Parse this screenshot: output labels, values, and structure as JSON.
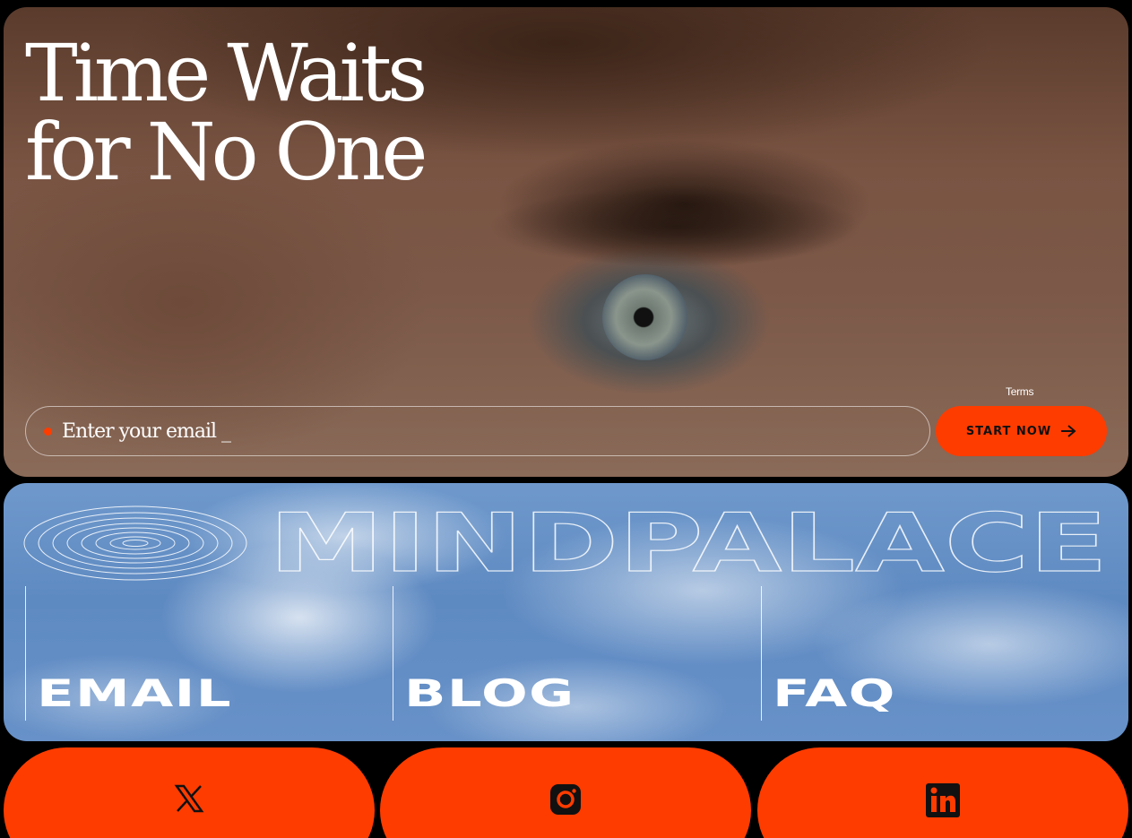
{
  "hero": {
    "title_line1": "Time Waits",
    "title_line2": "for No One",
    "terms_link": "Terms",
    "email_placeholder": "Enter your email _",
    "start_button": "START NOW"
  },
  "brand": {
    "name": "MINDPALACE"
  },
  "nav": [
    {
      "label": "EMAIL"
    },
    {
      "label": "BLOG"
    },
    {
      "label": "FAQ"
    }
  ],
  "social": [
    {
      "icon": "x-icon"
    },
    {
      "icon": "instagram-icon"
    },
    {
      "icon": "linkedin-icon"
    }
  ],
  "colors": {
    "accent": "#ff3c00",
    "background": "#000000",
    "text_light": "#ffffff"
  }
}
